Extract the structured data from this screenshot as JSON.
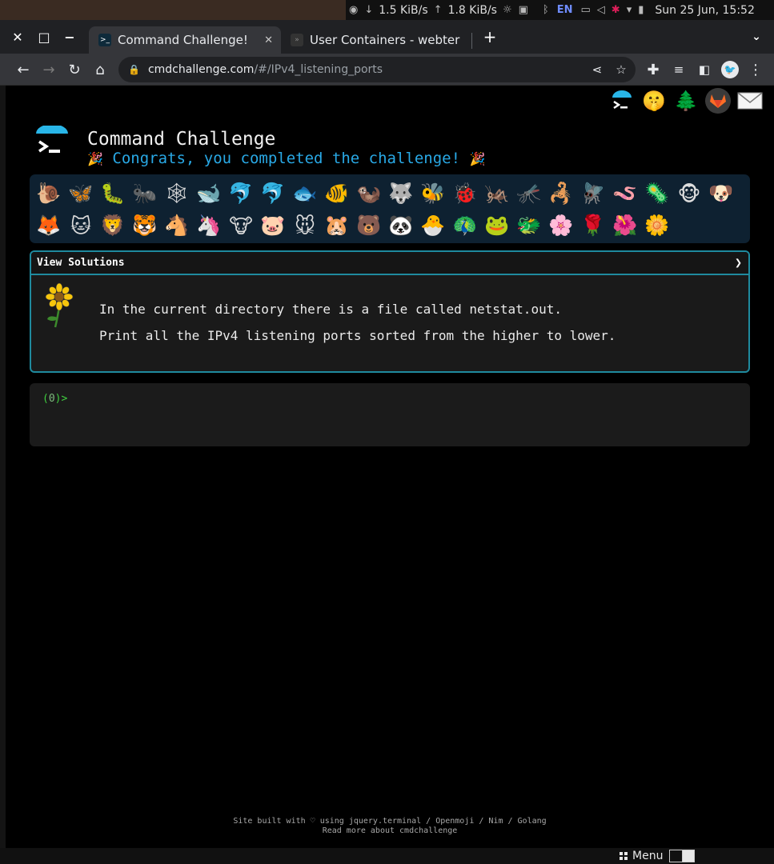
{
  "system_bar": {
    "net_down": "1.5 KiB/s",
    "net_up": "1.8 KiB/s",
    "lang": "EN",
    "clock": "Sun 25 Jun, 15:52"
  },
  "tabs": [
    {
      "title": "Command Challenge!",
      "active": true
    },
    {
      "title": "User Containers - webter",
      "active": false
    }
  ],
  "url": {
    "host": "cmdchallenge.com",
    "path": "/#/IPv4_listening_ports"
  },
  "page": {
    "title": "Command Challenge",
    "congrats": "Congrats, you completed the challenge!",
    "top_icons": [
      "cmdchallenge-logo",
      "shushing-face-icon",
      "tree-icon",
      "gitlab-icon",
      "mail-icon"
    ],
    "animals": [
      "🐌",
      "🦋",
      "🐛",
      "🐜",
      "🕸",
      "🐋",
      "🐬",
      "🐬",
      "🐟",
      "🐠",
      "🦦",
      "🐺",
      "🐝",
      "🐞",
      "🦗",
      "🦟",
      "🦂",
      "🪰",
      "🪱",
      "🦠",
      "🐵",
      "🐶",
      "🦊",
      "🐱",
      "🦁",
      "🐯",
      "🐴",
      "🦄",
      "🐮",
      "🐷",
      "🐭",
      "🐹",
      "🐻",
      "🐼",
      "🐣",
      "🦚",
      "🐸",
      "🐲",
      "🌸",
      "🌹",
      "🌺",
      "🌼"
    ],
    "solutions_label": "View Solutions",
    "problem_line1": "In the current directory there is a file called netstat.out.",
    "problem_line2": "Print all the IPv4 listening ports sorted from the higher to lower.",
    "prompt_open": "(",
    "prompt_num": "0",
    "prompt_close": ")>",
    "footer_line1": "Site built with ♡ using jquery.terminal / Openmoji / Nim / Golang",
    "footer_line2": "Read more about cmdchallenge"
  },
  "taskbar": {
    "menu_label": "Menu"
  }
}
